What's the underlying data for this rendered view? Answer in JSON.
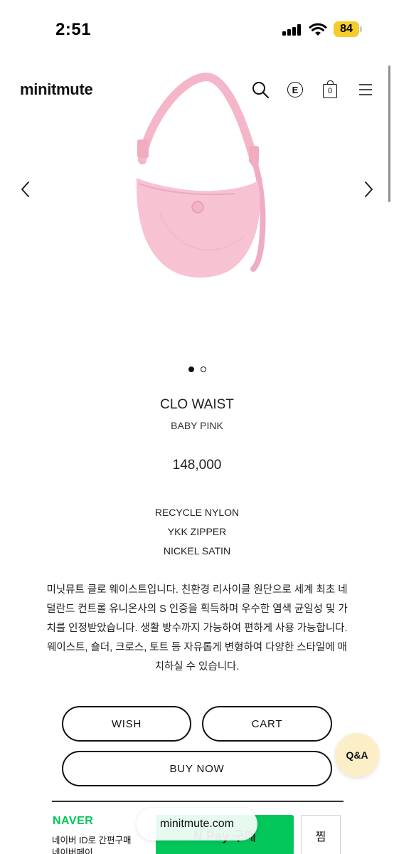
{
  "status": {
    "time": "2:51",
    "battery": "84"
  },
  "header": {
    "logo": "minitmute",
    "bag_count": "0"
  },
  "icons": {
    "search": "search-icon",
    "e": "E",
    "bag": "shopping-bag-icon",
    "menu": "hamburger-menu-icon",
    "prev": "chevron-left-icon",
    "next": "chevron-right-icon"
  },
  "gallery": {
    "image": "pink-crossbody-bag-photo",
    "slide_count": 2,
    "active_slide": 1
  },
  "product": {
    "name": "CLO WAIST",
    "color": "BABY PINK",
    "price": "148,000",
    "features": [
      "RECYCLE NYLON",
      "YKK ZIPPER",
      "NICKEL SATIN"
    ],
    "description_lines": [
      "미닛뮤트 클로 웨이스트입니다. 친환경 리사이클 원단으로 세계 최초 네",
      "덜란드 컨트롤 유니온사의 S 인증을 획득하며 우수한 염색 균일성 및 가",
      "치를 인정받았습니다. 생활 방수까지 가능하여 편하게 사용 가능합니다.",
      "웨이스트, 숄더, 크로스, 토트 등 자유롭게 변형하여 다양한 스타일에 매",
      "치하실 수 있습니다."
    ]
  },
  "actions": {
    "wish": "WISH",
    "cart": "CART",
    "buy_now": "BUY NOW",
    "qa": "Q&A"
  },
  "naver": {
    "brand": "NAVER",
    "line1": "네이버 ID로 간편구매",
    "line2": "네이버페이",
    "pay_button": "N Pay 구매",
    "zzim": "찜"
  },
  "browser": {
    "url": "minitmute.com"
  },
  "colors": {
    "accent_green": "#03c75a",
    "bag_pink": "#f6bfcf",
    "qa_bg": "#fcefc8",
    "battery": "#f5cc2a"
  }
}
